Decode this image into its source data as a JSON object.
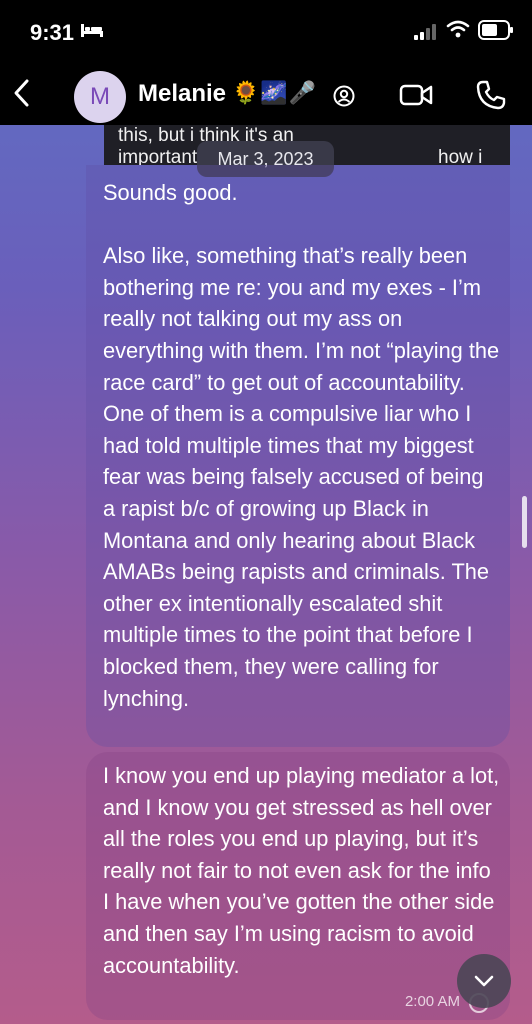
{
  "status_bar": {
    "time": "9:31",
    "icons": [
      "bed-icon",
      "signal-icon",
      "wifi-icon",
      "battery-icon"
    ]
  },
  "header": {
    "avatar_initial": "M",
    "contact_name": "Melanie",
    "name_emoji": "🌻🌌🎤",
    "icons": [
      "back-icon",
      "tag-icon",
      "video-call-icon",
      "phone-call-icon"
    ]
  },
  "conversation": {
    "quoted_preview": {
      "line1": "this, but i think it's an",
      "line2_left": "important",
      "line2_right": "how i"
    },
    "date_separator": "Mar 3, 2023",
    "messages": [
      {
        "text": "Sounds good.\n\nAlso like, something that’s really been bothering me re: you and my exes - I’m really not talking out my ass on everything with them. I’m not “playing the race card” to get out of accountability. One of them is a compulsive liar who I had told multiple times that my biggest fear was being falsely accused of being a rapist b/c of growing up Black in Montana and only hearing about Black AMABs being rapists and criminals. The other ex intentionally escalated shit multiple times to the point that before I blocked them, they were calling for lynching."
      },
      {
        "text": "I know you end up playing mediator a lot, and I know you get stressed as hell over all the roles you end up playing, but it’s really not fair to not even ask for the info I have when you’ve gotten the other side and then say I’m using racism to avoid accountability.",
        "timestamp": "2:00 AM"
      }
    ]
  },
  "colors": {
    "background_top": "#5d70c4",
    "background_bottom": "#b45c8b",
    "header_bg": "#000000",
    "avatar_bg": "#dcd3ee",
    "avatar_letter": "#7a4ab8"
  }
}
